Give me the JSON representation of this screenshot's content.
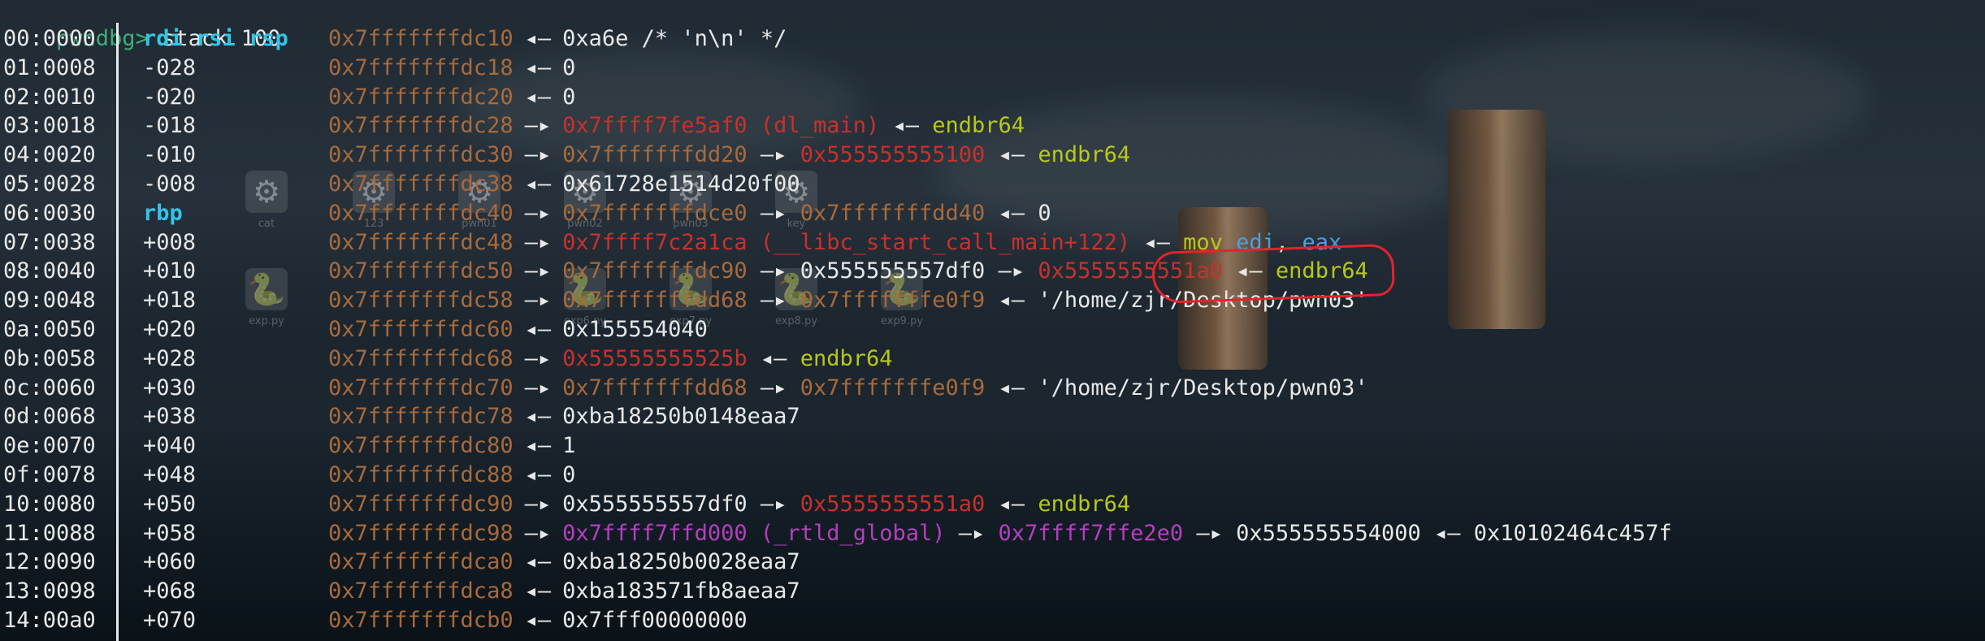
{
  "prompt": {
    "text": "pwndbg>",
    "command": " stack 100"
  },
  "rows": [
    {
      "idx": "00:0000",
      "off": "",
      "regs": "rdi rsi rsp",
      "addr": "0x7fffffffdc10",
      "arrow": "◂—",
      "parts": [
        {
          "t": "0xa6e /* 'n\\n' */",
          "c": "white"
        }
      ]
    },
    {
      "idx": "01:0008",
      "off": "-028",
      "regs": "",
      "addr": "0x7fffffffdc18",
      "arrow": "◂—",
      "parts": [
        {
          "t": "0",
          "c": "white"
        }
      ]
    },
    {
      "idx": "02:0010",
      "off": "-020",
      "regs": "",
      "addr": "0x7fffffffdc20",
      "arrow": "◂—",
      "parts": [
        {
          "t": "0",
          "c": "white"
        }
      ]
    },
    {
      "idx": "03:0018",
      "off": "-018",
      "regs": "",
      "addr": "0x7fffffffdc28",
      "arrow": "—▸",
      "parts": [
        {
          "t": "0x7ffff7fe5af0 (dl_main)",
          "c": "red"
        },
        {
          "t": " ◂— ",
          "c": "white"
        },
        {
          "t": "endbr64",
          "c": "yellow"
        }
      ]
    },
    {
      "idx": "04:0020",
      "off": "-010",
      "regs": "",
      "addr": "0x7fffffffdc30",
      "arrow": "—▸",
      "parts": [
        {
          "t": "0x7fffffffdd20",
          "c": "addr"
        },
        {
          "t": " —▸ ",
          "c": "white"
        },
        {
          "t": "0x555555555100",
          "c": "red"
        },
        {
          "t": " ◂— ",
          "c": "white"
        },
        {
          "t": "endbr64",
          "c": "yellow"
        }
      ]
    },
    {
      "idx": "05:0028",
      "off": "-008",
      "regs": "",
      "addr": "0x7fffffffdc38",
      "arrow": "◂—",
      "parts": [
        {
          "t": "0x61728e1514d20f00",
          "c": "white"
        }
      ]
    },
    {
      "idx": "06:0030",
      "off": "",
      "regs": "rbp",
      "addr": "0x7fffffffdc40",
      "arrow": "—▸",
      "parts": [
        {
          "t": "0x7fffffffdce0",
          "c": "addr"
        },
        {
          "t": " —▸ ",
          "c": "white"
        },
        {
          "t": "0x7fffffffdd40",
          "c": "addr"
        },
        {
          "t": " ◂— ",
          "c": "white"
        },
        {
          "t": "0",
          "c": "white"
        }
      ]
    },
    {
      "idx": "07:0038",
      "off": "+008",
      "regs": "",
      "addr": "0x7fffffffdc48",
      "arrow": "—▸",
      "parts": [
        {
          "t": "0x7ffff7c2a1ca (__libc_start_call_main+122)",
          "c": "red"
        },
        {
          "t": " ◂— ",
          "c": "white"
        },
        {
          "t": "mov ",
          "c": "yellow"
        },
        {
          "t": "edi",
          "c": "blue"
        },
        {
          "t": ", ",
          "c": "white"
        },
        {
          "t": "eax",
          "c": "blue"
        }
      ]
    },
    {
      "idx": "08:0040",
      "off": "+010",
      "regs": "",
      "addr": "0x7fffffffdc50",
      "arrow": "—▸",
      "parts": [
        {
          "t": "0x7fffffffdc90",
          "c": "addr"
        },
        {
          "t": " —▸ ",
          "c": "white"
        },
        {
          "t": "0x555555557df0",
          "c": "white"
        },
        {
          "t": " —▸ ",
          "c": "white"
        },
        {
          "t": "0x5555555551a0",
          "c": "red"
        },
        {
          "t": " ◂— ",
          "c": "white"
        },
        {
          "t": "endbr64",
          "c": "yellow"
        }
      ]
    },
    {
      "idx": "09:0048",
      "off": "+018",
      "regs": "",
      "addr": "0x7fffffffdc58",
      "arrow": "—▸",
      "parts": [
        {
          "t": "0x7fffffffdd68",
          "c": "addr"
        },
        {
          "t": " —▸ ",
          "c": "white"
        },
        {
          "t": "0x7fffffffe0f9",
          "c": "addr"
        },
        {
          "t": " ◂— ",
          "c": "white"
        },
        {
          "t": "'/home/zjr/Desktop/pwn03'",
          "c": "white"
        }
      ]
    },
    {
      "idx": "0a:0050",
      "off": "+020",
      "regs": "",
      "addr": "0x7fffffffdc60",
      "arrow": "◂—",
      "parts": [
        {
          "t": "0x155554040",
          "c": "white"
        }
      ]
    },
    {
      "idx": "0b:0058",
      "off": "+028",
      "regs": "",
      "addr": "0x7fffffffdc68",
      "arrow": "—▸",
      "parts": [
        {
          "t": "0x55555555525b",
          "c": "red"
        },
        {
          "t": " ◂— ",
          "c": "white"
        },
        {
          "t": "endbr64",
          "c": "yellow"
        }
      ]
    },
    {
      "idx": "0c:0060",
      "off": "+030",
      "regs": "",
      "addr": "0x7fffffffdc70",
      "arrow": "—▸",
      "parts": [
        {
          "t": "0x7fffffffdd68",
          "c": "addr"
        },
        {
          "t": " —▸ ",
          "c": "white"
        },
        {
          "t": "0x7fffffffe0f9",
          "c": "addr"
        },
        {
          "t": " ◂— ",
          "c": "white"
        },
        {
          "t": "'/home/zjr/Desktop/pwn03'",
          "c": "white"
        }
      ]
    },
    {
      "idx": "0d:0068",
      "off": "+038",
      "regs": "",
      "addr": "0x7fffffffdc78",
      "arrow": "◂—",
      "parts": [
        {
          "t": "0xba18250b0148eaa7",
          "c": "white"
        }
      ]
    },
    {
      "idx": "0e:0070",
      "off": "+040",
      "regs": "",
      "addr": "0x7fffffffdc80",
      "arrow": "◂—",
      "parts": [
        {
          "t": "1",
          "c": "white"
        }
      ]
    },
    {
      "idx": "0f:0078",
      "off": "+048",
      "regs": "",
      "addr": "0x7fffffffdc88",
      "arrow": "◂—",
      "parts": [
        {
          "t": "0",
          "c": "white"
        }
      ]
    },
    {
      "idx": "10:0080",
      "off": "+050",
      "regs": "",
      "addr": "0x7fffffffdc90",
      "arrow": "—▸",
      "parts": [
        {
          "t": "0x555555557df0",
          "c": "white"
        },
        {
          "t": " —▸ ",
          "c": "white"
        },
        {
          "t": "0x5555555551a0",
          "c": "red"
        },
        {
          "t": " ◂— ",
          "c": "white"
        },
        {
          "t": "endbr64",
          "c": "yellow"
        }
      ]
    },
    {
      "idx": "11:0088",
      "off": "+058",
      "regs": "",
      "addr": "0x7fffffffdc98",
      "arrow": "—▸",
      "parts": [
        {
          "t": "0x7ffff7ffd000 (_rtld_global)",
          "c": "magenta"
        },
        {
          "t": " —▸ ",
          "c": "white"
        },
        {
          "t": "0x7ffff7ffe2e0",
          "c": "magenta"
        },
        {
          "t": " —▸ ",
          "c": "white"
        },
        {
          "t": "0x555555554000",
          "c": "white"
        },
        {
          "t": " ◂— ",
          "c": "white"
        },
        {
          "t": "0x10102464c457f",
          "c": "white"
        }
      ]
    },
    {
      "idx": "12:0090",
      "off": "+060",
      "regs": "",
      "addr": "0x7fffffffdca0",
      "arrow": "◂—",
      "parts": [
        {
          "t": "0xba18250b0028eaa7",
          "c": "white"
        }
      ]
    },
    {
      "idx": "13:0098",
      "off": "+068",
      "regs": "",
      "addr": "0x7fffffffdca8",
      "arrow": "◂—",
      "parts": [
        {
          "t": "0xba183571fb8aeaa7",
          "c": "white"
        }
      ]
    },
    {
      "idx": "14:00a0",
      "off": "+070",
      "regs": "",
      "addr": "0x7fffffffdcb0",
      "arrow": "◂—",
      "parts": [
        {
          "t": "0x7fff00000000",
          "c": "white"
        }
      ]
    }
  ],
  "desktop_icons": [
    {
      "label": "cat",
      "glyph": "⚙"
    },
    {
      "label": "123",
      "glyph": "⚙"
    },
    {
      "label": "pwn01",
      "glyph": "⚙"
    },
    {
      "label": "pwn02",
      "glyph": "⚙"
    },
    {
      "label": "pwn03",
      "glyph": "⚙"
    },
    {
      "label": "key",
      "glyph": "⚙"
    },
    {
      "label": "exp.py",
      "glyph": "🐍"
    },
    {
      "label": "exp6.py",
      "glyph": "🐍"
    },
    {
      "label": "exp7.py",
      "glyph": "🐍"
    },
    {
      "label": "exp8.py",
      "glyph": "🐍"
    },
    {
      "label": "exp9.py",
      "glyph": "🐍"
    }
  ],
  "colors": {
    "prompt": "#3fae7a",
    "register": "#33c5e8",
    "stack_addr": "#a86a3c",
    "code_ptr": "#c8312c",
    "instr": "#b8c818",
    "data_ptr": "#b43fc0",
    "annotation": "#e4232b"
  }
}
